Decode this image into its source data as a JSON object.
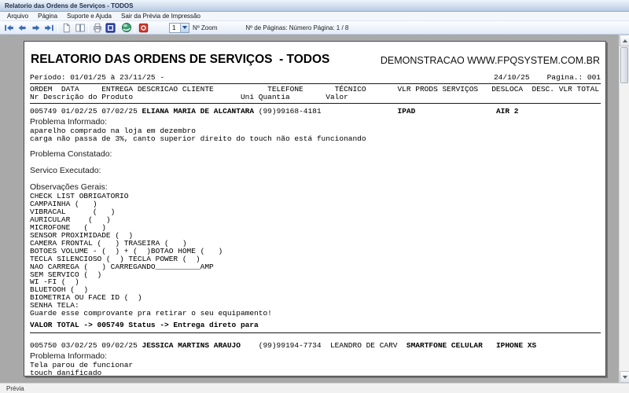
{
  "window": {
    "title": "Relatorio das Ordens de Serviços - TODOS"
  },
  "menu": {
    "items": [
      "Arquivo",
      "Página",
      "Suporte e Ajuda",
      "Sair da Prévia de Impressão"
    ]
  },
  "toolbar": {
    "zoom_value": "1",
    "zoom_label": "Nº Zoom",
    "pages_label": "Nº de Páginas: Número Página: 1 / 8"
  },
  "report": {
    "title": "RELATORIO DAS ORDENS DE SERVIÇOS  - TODOS",
    "watermark": "DEMONSTRACAO WWW.FPQSYSTEM.COM.BR",
    "period": "Período: 01/01/25 à 23/11/25 -",
    "print_date": "24/10/25",
    "page_label": "Pagina.: 001",
    "header_line1": "ORDEM  DATA     ENTREGA DESCRICAO CLIENTE            TELEFONE       TÉCNICO       VLR PRODS SERVIÇOS   DESLOCA  DESC. VLR TOTAL",
    "header_line2": "Nr Descrição do Produto                        Uni Quantia        Valor",
    "sections": {
      "problema_informado": "Problema Informado:",
      "problema_constatado": "Problema Constatado:",
      "servico_executado": "Servico Executado:",
      "observacoes_gerais": "Observações Gerais:"
    },
    "record1": {
      "segments": [
        {
          "t": "005749 01/02/25 07/02/25 ",
          "n": "order-and-dates"
        },
        {
          "t": "ELIANA MARIA DE ALCANTARA",
          "b": true,
          "n": "client-name"
        },
        {
          "t": " (99)99168-4181                 ",
          "n": "phone"
        },
        {
          "t": "IPAD",
          "b": true,
          "n": "product"
        },
        {
          "t": "                  ",
          "n": "spacer"
        },
        {
          "t": "AIR 2",
          "b": true,
          "n": "model"
        }
      ],
      "problema_informado_lines": [
        "aparelho comprado na loja em dezembro",
        "carga não passa de 3%, canto superior direito do touch não está funcionando"
      ],
      "checklist": [
        "CHECK LIST OBRIGATORIO",
        "CAMPAINHA (   )",
        "VIBRACAL      (   )",
        "AURICULAR    (   )",
        "MICROFONE   (   )",
        "SENSOR PROXIMIDADE (  )",
        "CAMERA FRONTAL (   ) TRASEIRA (   )",
        "BOTOES VOLUME - (  ) + (  )BOTAO HOME (   )",
        "TECLA SILENCIOSO (  ) TECLA POWER (  )",
        "NAO CARREGA (   ) CARREGANDO__________AMP",
        "SEM SERVICO (  )",
        "WI -FI (  )",
        "BLUETOOH (  )",
        "BIOMETRIA OU FACE ID (  )",
        "SENHA TELA:",
        "Guarde esse comprovante pra retirar o seu equipamento!"
      ],
      "valor_total": "VALOR TOTAL -> 005749 Status -> Entrega direto para"
    },
    "record2": {
      "segments": [
        {
          "t": "005750 03/02/25 09/02/25 ",
          "n": "order-and-dates"
        },
        {
          "t": "JESSICA MARTINS ARAUJO",
          "b": true,
          "n": "client-name"
        },
        {
          "t": "    (99)99194-7734  ",
          "n": "phone"
        },
        {
          "t": "LEANDRO DE CARV  ",
          "n": "technician"
        },
        {
          "t": "SMARTFONE CELULAR",
          "b": true,
          "n": "product"
        },
        {
          "t": "   ",
          "n": "spacer"
        },
        {
          "t": "IPHONE XS",
          "b": true,
          "n": "model"
        }
      ],
      "problema_informado_lines": [
        "Tela parou de funcionar",
        "touch danificado"
      ]
    }
  },
  "statusbar": {
    "text": "Prévia"
  }
}
